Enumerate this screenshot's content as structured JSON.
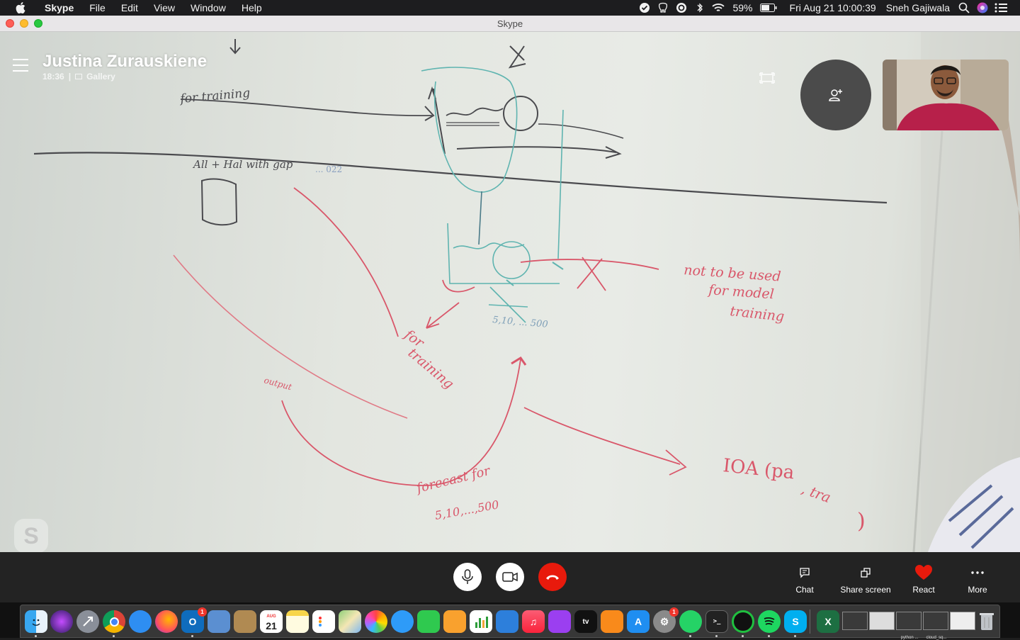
{
  "menubar": {
    "app_name": "Skype",
    "menus": [
      "File",
      "Edit",
      "View",
      "Window",
      "Help"
    ],
    "battery": "59%",
    "datetime": "Fri Aug 21  10:00:39",
    "user": "Sneh Gajiwala"
  },
  "window": {
    "title": "Skype"
  },
  "call": {
    "caller_name": "Justina Zurauskiene",
    "duration": "18:36",
    "separator": "|",
    "view_mode": "Gallery"
  },
  "whiteboard": {
    "texts": {
      "t1": "for training",
      "t2": "All + Hal with gap",
      "t3": "... 022",
      "t4": "not to be used",
      "t5": "for model",
      "t6": "training",
      "t7": "5,10, ... 500",
      "t8": "for",
      "t9": "training",
      "t10": "output",
      "t11": "forecast for",
      "t12": "5,10,...,500",
      "t13": "IOA (pa",
      "t14": ", tra",
      "t15": ")"
    }
  },
  "controls": {
    "chat_label": "Chat",
    "share_label": "Share screen",
    "react_label": "React",
    "more_label": "More"
  },
  "dock": {
    "calendar_month": "AUG",
    "calendar_day": "21",
    "outlook_badge": "1",
    "prefs_badge": "1",
    "mini_windows": [
      "",
      "",
      "python ...",
      "cloud_sq..."
    ]
  },
  "colors": {
    "hangup": "#e81a0c",
    "react_heart": "#e81a0c",
    "marker_red": "#d9576a",
    "marker_teal": "#5fb4b0",
    "marker_dark": "#4a4a4e"
  }
}
